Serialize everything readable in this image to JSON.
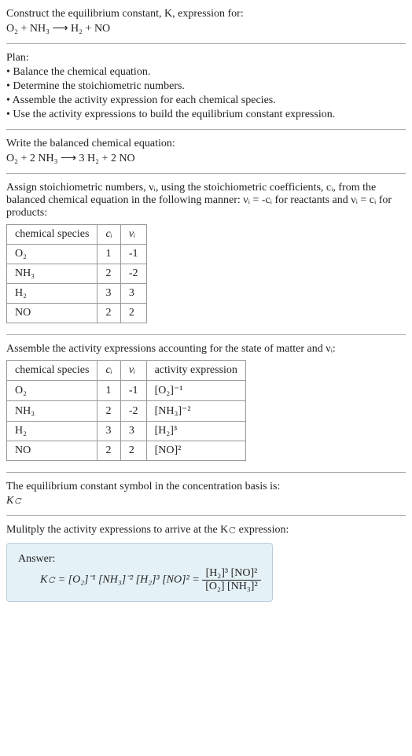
{
  "intro": {
    "line1": "Construct the equilibrium constant, K, expression for:",
    "equation": "O₂ + NH₃ ⟶ H₂ + NO"
  },
  "plan": {
    "title": "Plan:",
    "items": [
      "• Balance the chemical equation.",
      "• Determine the stoichiometric numbers.",
      "• Assemble the activity expression for each chemical species.",
      "• Use the activity expressions to build the equilibrium constant expression."
    ]
  },
  "balanced": {
    "title": "Write the balanced chemical equation:",
    "equation": "O₂ + 2 NH₃ ⟶ 3 H₂ + 2 NO"
  },
  "assign": {
    "text": "Assign stoichiometric numbers, νᵢ, using the stoichiometric coefficients, cᵢ, from the balanced chemical equation in the following manner: νᵢ = -cᵢ for reactants and νᵢ = cᵢ for products:",
    "headers": {
      "h1": "chemical species",
      "h2": "cᵢ",
      "h3": "νᵢ"
    },
    "rows": [
      {
        "species": "O₂",
        "c": "1",
        "v": "-1"
      },
      {
        "species": "NH₃",
        "c": "2",
        "v": "-2"
      },
      {
        "species": "H₂",
        "c": "3",
        "v": "3"
      },
      {
        "species": "NO",
        "c": "2",
        "v": "2"
      }
    ]
  },
  "activity": {
    "text": "Assemble the activity expressions accounting for the state of matter and νᵢ:",
    "headers": {
      "h1": "chemical species",
      "h2": "cᵢ",
      "h3": "νᵢ",
      "h4": "activity expression"
    },
    "rows": [
      {
        "species": "O₂",
        "c": "1",
        "v": "-1",
        "expr": "[O₂]⁻¹"
      },
      {
        "species": "NH₃",
        "c": "2",
        "v": "-2",
        "expr": "[NH₃]⁻²"
      },
      {
        "species": "H₂",
        "c": "3",
        "v": "3",
        "expr": "[H₂]³"
      },
      {
        "species": "NO",
        "c": "2",
        "v": "2",
        "expr": "[NO]²"
      }
    ]
  },
  "symbol": {
    "line1": "The equilibrium constant symbol in the concentration basis is:",
    "line2": "K𝚌"
  },
  "multiply": {
    "text": "Mulitply the activity expressions to arrive at the K𝚌 expression:"
  },
  "answer": {
    "label": "Answer:",
    "lhs": "K𝚌 = [O₂]⁻¹ [NH₃]⁻² [H₂]³ [NO]² =",
    "num": "[H₂]³ [NO]²",
    "den": "[O₂] [NH₃]²"
  },
  "chart_data": {
    "type": "table",
    "tables": [
      {
        "title": "Stoichiometric numbers",
        "columns": [
          "chemical species",
          "c_i",
          "ν_i"
        ],
        "rows": [
          [
            "O2",
            1,
            -1
          ],
          [
            "NH3",
            2,
            -2
          ],
          [
            "H2",
            3,
            3
          ],
          [
            "NO",
            2,
            2
          ]
        ]
      },
      {
        "title": "Activity expressions",
        "columns": [
          "chemical species",
          "c_i",
          "ν_i",
          "activity expression"
        ],
        "rows": [
          [
            "O2",
            1,
            -1,
            "[O2]^-1"
          ],
          [
            "NH3",
            2,
            -2,
            "[NH3]^-2"
          ],
          [
            "H2",
            3,
            3,
            "[H2]^3"
          ],
          [
            "NO",
            2,
            2,
            "[NO]^2"
          ]
        ]
      }
    ]
  }
}
